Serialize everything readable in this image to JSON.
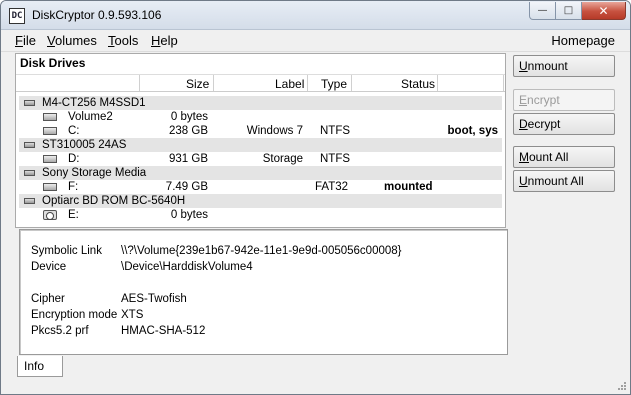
{
  "window": {
    "title": "DiskCryptor 0.9.593.106",
    "app_icon_text": "DC",
    "minimize_glyph": "—",
    "maximize_glyph": "□",
    "close_glyph": "✕"
  },
  "menu": {
    "file": {
      "accel": "F",
      "rest": "ile"
    },
    "volumes": {
      "accel": "V",
      "rest": "olumes"
    },
    "tools": {
      "accel": "T",
      "rest": "ools"
    },
    "help": {
      "accel": "H",
      "rest": "elp"
    },
    "homepage": "Homepage"
  },
  "drives_panel": {
    "title": "Disk Drives",
    "columns": {
      "size": "Size",
      "label": "Label",
      "type": "Type",
      "status": "Status"
    },
    "rows": [
      {
        "kind": "disk",
        "name": "M4-CT256 M4SSD1"
      },
      {
        "kind": "volume",
        "name": "Volume2",
        "size": "0 bytes",
        "label": "",
        "type": "",
        "status": ""
      },
      {
        "kind": "volume",
        "name": "C:",
        "size": "238 GB",
        "label": "Windows 7",
        "type": "NTFS",
        "status": "boot, sys"
      },
      {
        "kind": "disk",
        "name": "ST310005 24AS"
      },
      {
        "kind": "volume",
        "name": "D:",
        "size": "931 GB",
        "label": "Storage",
        "type": "NTFS",
        "status": ""
      },
      {
        "kind": "disk",
        "name": "Sony Storage Media"
      },
      {
        "kind": "volume",
        "name": "F:",
        "size": "7.49 GB",
        "label": "",
        "type": "FAT32",
        "status": "mounted"
      },
      {
        "kind": "disk",
        "name": "Optiarc BD ROM BC-5640H"
      },
      {
        "kind": "cdrom",
        "name": "E:",
        "size": "0 bytes",
        "label": "",
        "type": "",
        "status": ""
      }
    ]
  },
  "buttons": {
    "unmount": {
      "accel": "U",
      "rest": "nmount",
      "enabled": true
    },
    "encrypt": {
      "accel": "E",
      "rest": "ncrypt",
      "enabled": false
    },
    "decrypt": {
      "accel": "D",
      "rest": "ecrypt",
      "enabled": true
    },
    "mount_all": {
      "accel": "M",
      "rest": "ount All",
      "enabled": true
    },
    "unmount_all": {
      "accel": "U",
      "rest": "nmount All",
      "enabled": true
    }
  },
  "info": {
    "symbolic_link": {
      "label": "Symbolic Link",
      "value": "\\\\?\\Volume{239e1b67-942e-11e1-9e9d-005056c00008}"
    },
    "device": {
      "label": "Device",
      "value": "\\Device\\HarddiskVolume4"
    },
    "cipher": {
      "label": "Cipher",
      "value": "AES-Twofish"
    },
    "encryption_mode": {
      "label": "Encryption mode",
      "value": "XTS"
    },
    "pkcs": {
      "label": "Pkcs5.2 prf",
      "value": "HMAC-SHA-512"
    }
  },
  "tabs": {
    "info": "Info"
  }
}
